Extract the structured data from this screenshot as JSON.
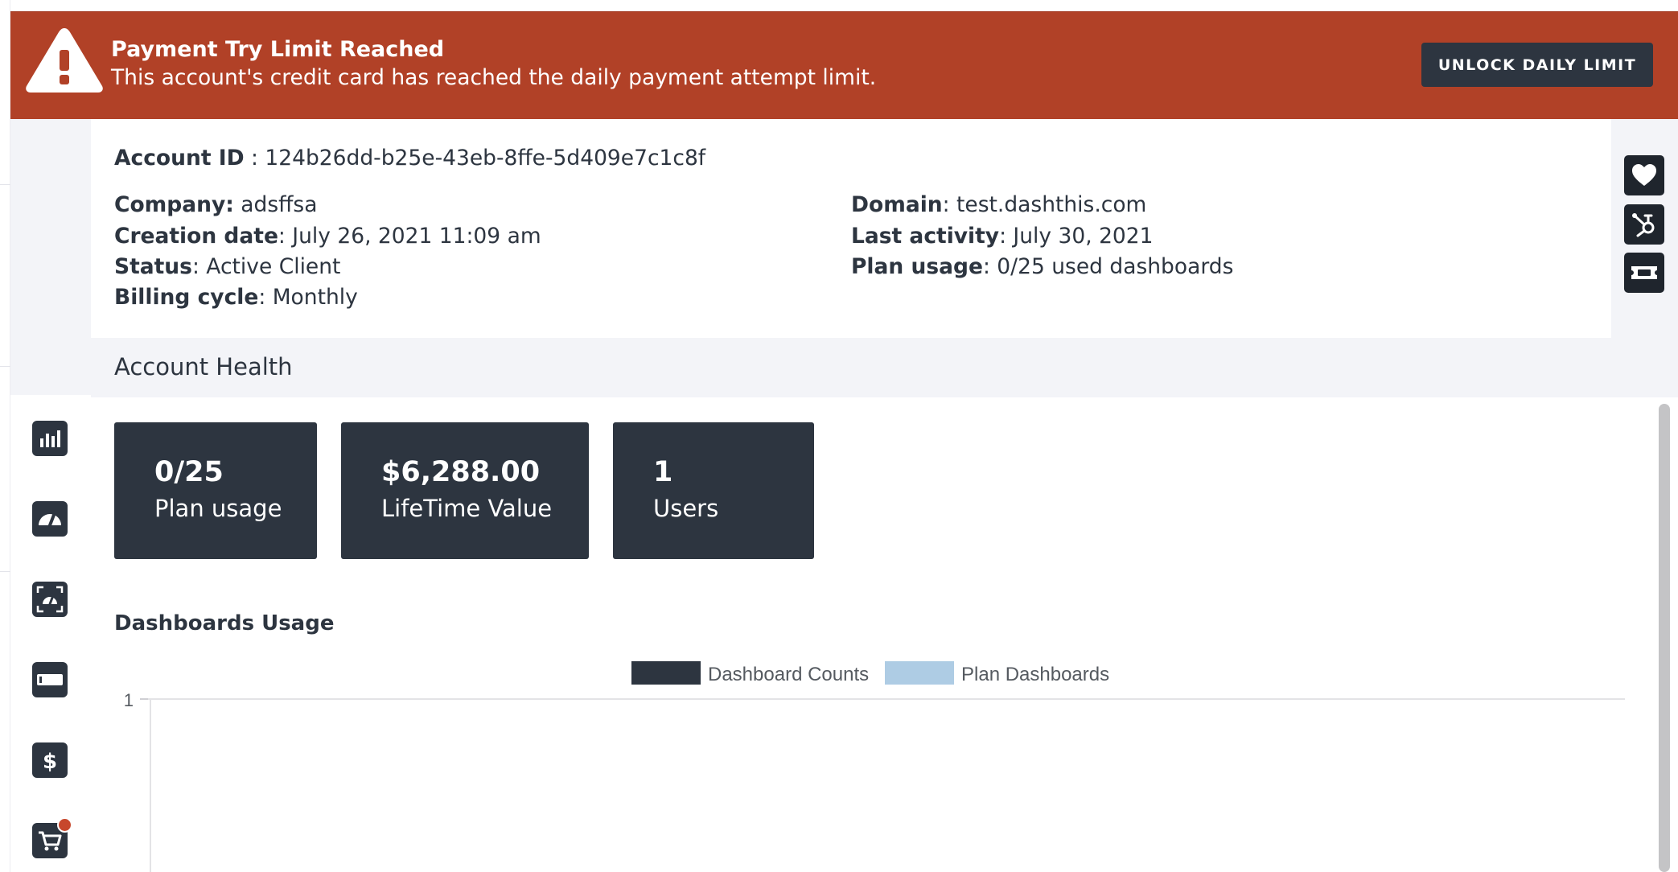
{
  "banner": {
    "title": "Payment Try Limit Reached",
    "message": "This account's credit card has reached the daily payment attempt limit.",
    "button_label": "UNLOCK DAILY LIMIT",
    "color": "#b14127",
    "icon": "warning-triangle-icon"
  },
  "account": {
    "id_label": "Account ID",
    "id_value": " : 124b26dd-b25e-43eb-8ffe-5d409e7c1c8f",
    "company_label": "Company:",
    "company_value": " adsffsa",
    "creation_label": "Creation date",
    "creation_value": ": July 26, 2021 11:09 am",
    "status_label": "Status",
    "status_value": ": Active Client",
    "billing_label": "Billing cycle",
    "billing_value": ": Monthly",
    "domain_label": "Domain",
    "domain_value": ": test.dashthis.com",
    "last_activity_label": "Last activity",
    "last_activity_value": ": July 30, 2021",
    "plan_usage_label": "Plan usage",
    "plan_usage_value": ": 0/25 used dashboards"
  },
  "health": {
    "title": "Account Health",
    "cards": [
      {
        "value": "0/25",
        "label": "Plan usage"
      },
      {
        "value": "$6,288.00",
        "label": "LifeTime Value"
      },
      {
        "value": "1",
        "label": "Users"
      }
    ]
  },
  "nav": {
    "items": [
      {
        "icon": "bar-chart-icon",
        "active": true
      },
      {
        "icon": "speedometer-icon"
      },
      {
        "icon": "gauge-frame-icon"
      },
      {
        "icon": "progress-bar-icon"
      },
      {
        "icon": "dollar-icon"
      },
      {
        "icon": "shopping-cart-icon",
        "badge": true
      }
    ]
  },
  "side_actions": [
    {
      "icon": "heart-icon"
    },
    {
      "icon": "hubspot-icon"
    },
    {
      "icon": "ticket-icon"
    }
  ],
  "chart_data": {
    "type": "bar",
    "title": "Dashboards Usage",
    "series": [
      {
        "name": "Dashboard Counts",
        "color": "#2d3540",
        "values": []
      },
      {
        "name": "Plan Dashboards",
        "color": "#aecce4",
        "values": []
      }
    ],
    "y_ticks": [
      "1"
    ],
    "legend_position": "top-center",
    "grid": true
  }
}
